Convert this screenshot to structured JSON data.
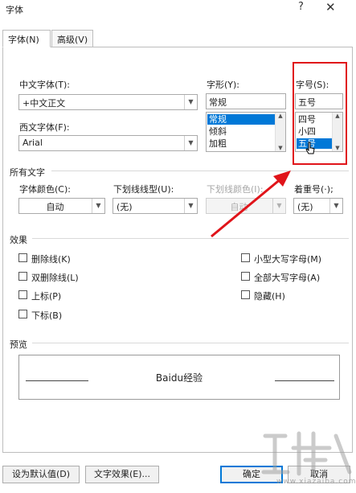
{
  "dialog": {
    "title": "字体",
    "help": "?",
    "close": "✕"
  },
  "tabs": [
    {
      "label": "字体(N)",
      "active": true
    },
    {
      "label": "高级(V)",
      "active": false
    }
  ],
  "chinese_font": {
    "label": "中文字体(T):",
    "value": "+中文正文"
  },
  "western_font": {
    "label": "西文字体(F):",
    "value": "Arial"
  },
  "style": {
    "label": "字形(Y):",
    "value": "常规",
    "options": [
      "常规",
      "倾斜",
      "加粗"
    ],
    "selected": "常规"
  },
  "size": {
    "label": "字号(S):",
    "value": "五号",
    "options": [
      "四号",
      "小四",
      "五号"
    ],
    "selected": "五号"
  },
  "all_text": {
    "heading": "所有文字",
    "font_color": {
      "label": "字体颜色(C):",
      "value": "自动"
    },
    "underline_type": {
      "label": "下划线线型(U):",
      "value": "(无)"
    },
    "underline_color": {
      "label": "下划线颜色(I):",
      "value": "自动"
    },
    "emphasis": {
      "label": "着重号(·);",
      "value": "(无)"
    }
  },
  "effects": {
    "heading": "效果",
    "left": [
      "删除线(K)",
      "双删除线(L)",
      "上标(P)",
      "下标(B)"
    ],
    "right": [
      "小型大写字母(M)",
      "全部大写字母(A)",
      "隐藏(H)"
    ]
  },
  "preview": {
    "heading": "预览",
    "sample": "Baidu经验"
  },
  "buttons": {
    "set_default": "设为默认值(D)",
    "text_effects": "文字效果(E)...",
    "ok": "确定",
    "cancel": "取消"
  },
  "colors": {
    "annotation": "#e0141a",
    "selection": "#0078d7"
  }
}
